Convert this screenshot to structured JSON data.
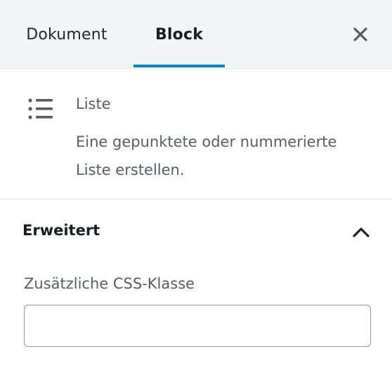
{
  "tabs": {
    "document_label": "Dokument",
    "block_label": "Block",
    "active": "Block"
  },
  "close": {
    "icon": "close-icon"
  },
  "block": {
    "icon": "list-icon",
    "title": "Liste",
    "description": "Eine gepunktete oder nummerierte Liste erstellen."
  },
  "advanced": {
    "title": "Erweitert",
    "expanded": true,
    "toggle_icon": "chevron-up-icon",
    "css_class_label": "Zusätzliche CSS-Klasse",
    "css_class_value": ""
  },
  "colors": {
    "accent": "#0085ba",
    "header_bg": "#f3f4f5",
    "muted_text": "#555d66",
    "border": "#e2e4e7"
  }
}
